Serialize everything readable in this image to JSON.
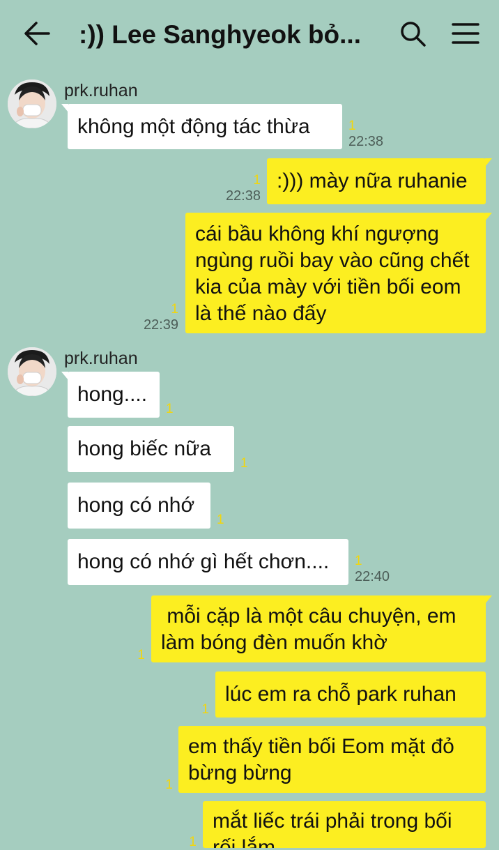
{
  "header": {
    "back_icon": "arrow-left-icon",
    "title": ":)) Lee Sanghyeok bỏ...",
    "search_icon": "search-icon",
    "menu_icon": "hamburger-menu-icon"
  },
  "colors": {
    "background": "#a5cdbf",
    "incoming_bubble": "#ffffff",
    "outgoing_bubble": "#fcee21",
    "unread_count": "#f2d60c"
  },
  "messages": [
    {
      "sender": "prk.ruhan",
      "text": "không một động tác thừa",
      "unread": "1",
      "time": "22:38"
    },
    {
      "text": ":))) mày nữa ruhanie",
      "unread": "1",
      "time": "22:38"
    },
    {
      "text": "cái bầu không khí ngượng ngùng ruồi bay vào cũng chết kia của mày với tiền bối eom là thế nào đấy",
      "unread": "1",
      "time": "22:39"
    },
    {
      "sender": "prk.ruhan",
      "text": "hong....",
      "unread": "1"
    },
    {
      "text": "hong biếc nữa",
      "unread": "1"
    },
    {
      "text": "hong có nhớ",
      "unread": "1"
    },
    {
      "text": "hong có nhớ gì hết chơn....",
      "unread": "1",
      "time": "22:40"
    },
    {
      "text": " mỗi cặp là một câu chuyện, em làm bóng đèn muốn khờ",
      "unread": "1"
    },
    {
      "text": "lúc em ra chỗ park ruhan",
      "unread": "1"
    },
    {
      "text": "em thấy tiền bối Eom mặt đỏ bừng bừng",
      "unread": "1"
    },
    {
      "text": "mắt liếc trái phải trong bối rối lắm",
      "unread": "1"
    }
  ]
}
